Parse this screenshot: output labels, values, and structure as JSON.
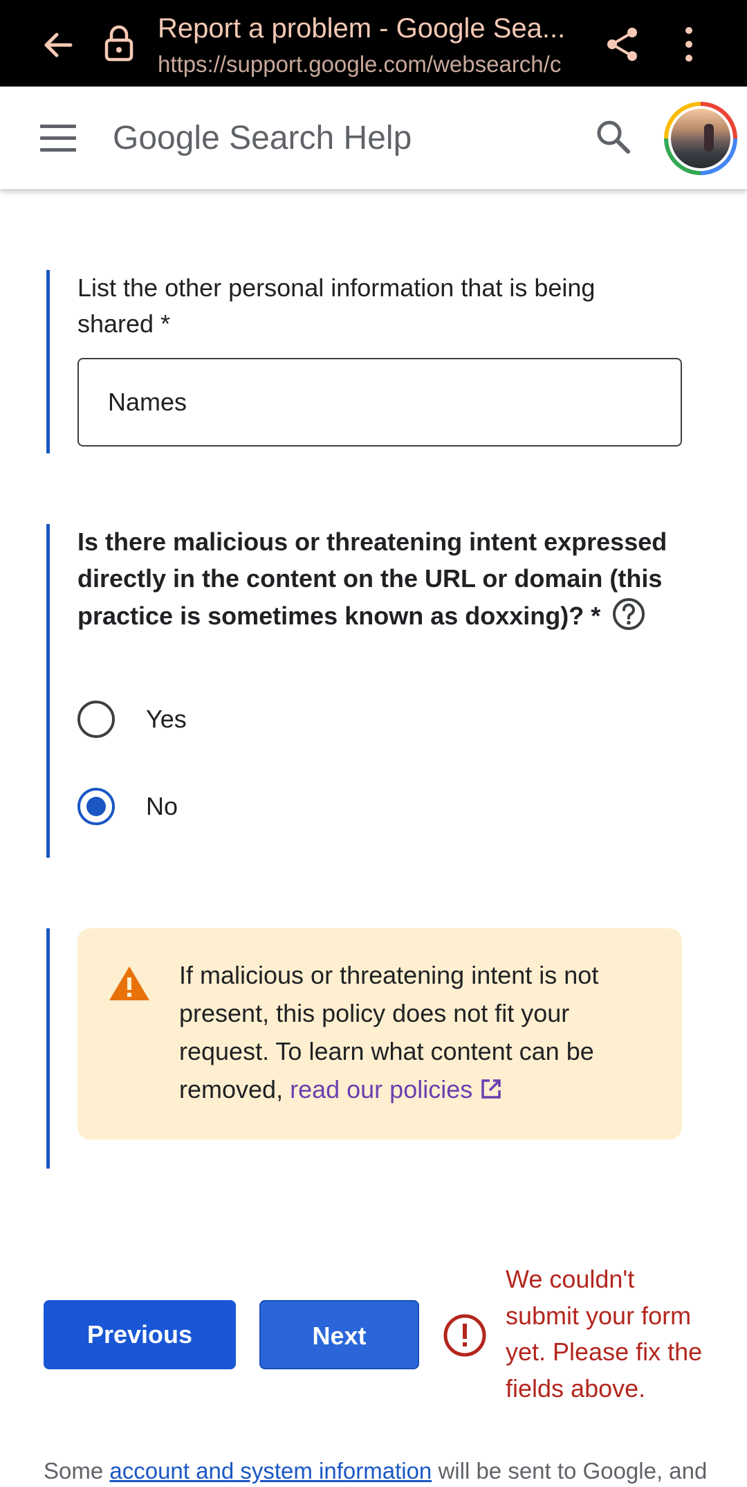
{
  "browser": {
    "title": "Report a problem - Google Sea...",
    "url": "https://support.google.com/websearch/c"
  },
  "header": {
    "site_title": "Google Search Help"
  },
  "form": {
    "other_info_label": "List the other personal information that is being shared *",
    "other_info_value": "Names",
    "question": "Is there malicious or threatening intent expressed directly in the content on the URL or domain (this practice is sometimes known as doxxing)? *",
    "options": [
      {
        "label": "Yes",
        "selected": false
      },
      {
        "label": "No",
        "selected": true
      }
    ],
    "warning": {
      "text_before": "If malicious or threatening intent is not present, this policy does not fit your request. To learn what content can be removed, ",
      "link": "read our policies"
    }
  },
  "actions": {
    "previous_label": "Previous",
    "next_label": "Next",
    "error_message": "We couldn't submit your form yet. Please fix the fields above."
  },
  "footer": {
    "before": "Some ",
    "link": "account and system information",
    "after": " will be sent to Google, and"
  },
  "colors": {
    "accent": "#1a57c4",
    "error": "#b3261e",
    "warning_bg": "#fdefd0",
    "warning_icon": "#e8710a",
    "link_visited": "#6b3fb0"
  }
}
